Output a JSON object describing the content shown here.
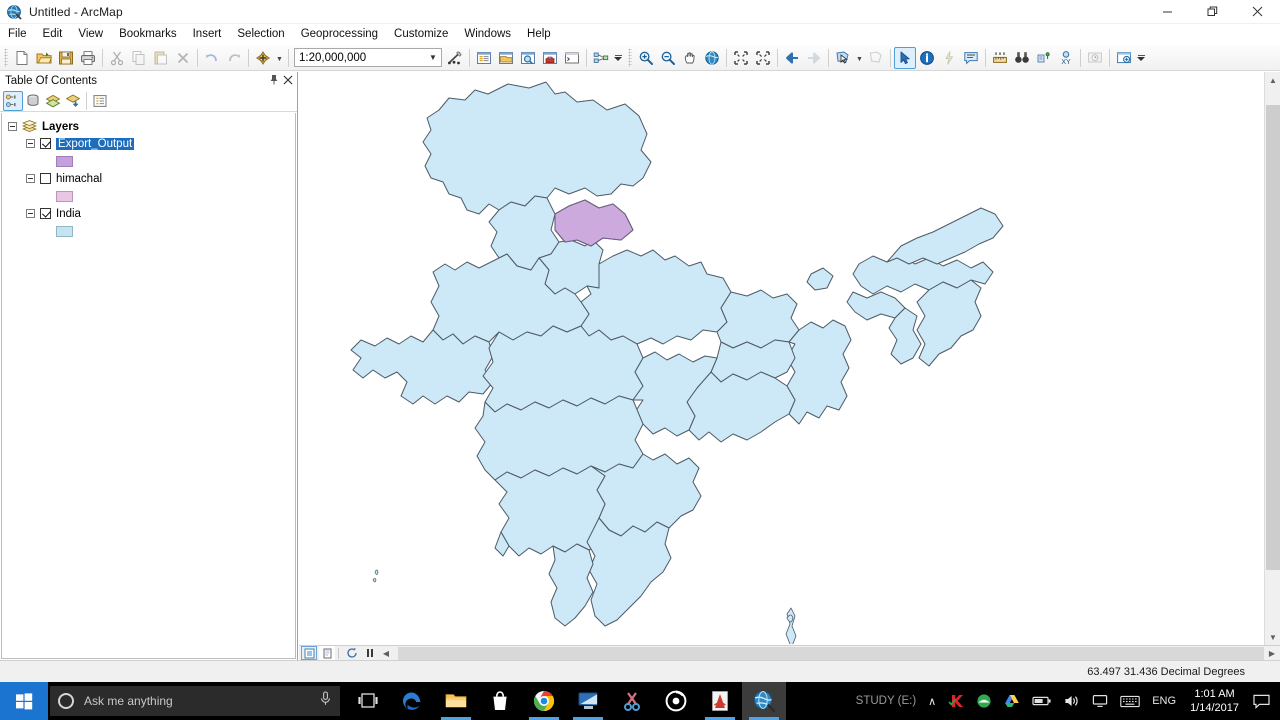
{
  "window": {
    "title": "Untitled - ArcMap",
    "app_icon": "arcmap-globe-icon",
    "minimize": "—",
    "maximize": "❐",
    "close": "✕"
  },
  "menubar": {
    "items": [
      {
        "label": "File",
        "name": "menu-file"
      },
      {
        "label": "Edit",
        "name": "menu-edit"
      },
      {
        "label": "View",
        "name": "menu-view"
      },
      {
        "label": "Bookmarks",
        "name": "menu-bookmarks"
      },
      {
        "label": "Insert",
        "name": "menu-insert"
      },
      {
        "label": "Selection",
        "name": "menu-selection"
      },
      {
        "label": "Geoprocessing",
        "name": "menu-geoprocessing"
      },
      {
        "label": "Customize",
        "name": "menu-customize"
      },
      {
        "label": "Windows",
        "name": "menu-windows"
      },
      {
        "label": "Help",
        "name": "menu-help"
      }
    ]
  },
  "toolbar": {
    "scale": {
      "value": "1:20,000,000",
      "chevron": "▼"
    },
    "buttons": [
      {
        "name": "new-map-button",
        "icon": "new-document-icon",
        "enabled": true
      },
      {
        "name": "open-button",
        "icon": "open-folder-icon",
        "enabled": true
      },
      {
        "name": "save-button",
        "icon": "save-disk-icon",
        "enabled": true
      },
      {
        "name": "print-button",
        "icon": "printer-icon",
        "enabled": true
      },
      {
        "name": "cut-button",
        "icon": "scissors-icon",
        "enabled": false
      },
      {
        "name": "copy-button",
        "icon": "copy-icon",
        "enabled": false
      },
      {
        "name": "paste-button",
        "icon": "paste-icon",
        "enabled": false
      },
      {
        "name": "delete-button",
        "icon": "delete-x-icon",
        "enabled": false
      },
      {
        "name": "undo-button",
        "icon": "undo-arrow-icon",
        "enabled": false
      },
      {
        "name": "redo-button",
        "icon": "redo-arrow-icon",
        "enabled": false
      },
      {
        "name": "add-data-button",
        "icon": "add-data-plus-icon",
        "enabled": true
      },
      {
        "name": "editor-toolbar-button",
        "icon": "editor-pencil-icon",
        "enabled": true
      },
      {
        "name": "table-of-contents-button",
        "icon": "toc-window-icon",
        "enabled": true
      },
      {
        "name": "catalog-button",
        "icon": "catalog-window-icon",
        "enabled": true
      },
      {
        "name": "search-window-button",
        "icon": "search-window-icon",
        "enabled": true
      },
      {
        "name": "arctoolbox-button",
        "icon": "toolbox-red-icon",
        "enabled": true
      },
      {
        "name": "python-window-button",
        "icon": "python-window-icon",
        "enabled": true
      },
      {
        "name": "model-builder-button",
        "icon": "model-builder-icon",
        "enabled": true
      },
      {
        "name": "zoom-in-button",
        "icon": "zoom-in-magnifier-icon",
        "enabled": true
      },
      {
        "name": "zoom-out-button",
        "icon": "zoom-out-magnifier-icon",
        "enabled": true
      },
      {
        "name": "pan-button",
        "icon": "pan-hand-icon",
        "enabled": true
      },
      {
        "name": "full-extent-button",
        "icon": "globe-full-extent-icon",
        "enabled": true
      },
      {
        "name": "fixed-zoom-in-button",
        "icon": "fixed-zoom-in-icon",
        "enabled": true
      },
      {
        "name": "fixed-zoom-out-button",
        "icon": "fixed-zoom-out-icon",
        "enabled": true
      },
      {
        "name": "go-back-extent-button",
        "icon": "back-arrow-icon",
        "enabled": true
      },
      {
        "name": "go-next-extent-button",
        "icon": "forward-arrow-icon",
        "enabled": false
      },
      {
        "name": "select-features-button",
        "icon": "select-features-icon",
        "enabled": true
      },
      {
        "name": "clear-selection-button",
        "icon": "clear-selection-icon",
        "enabled": false
      },
      {
        "name": "select-elements-button",
        "icon": "arrow-pointer-icon",
        "enabled": true,
        "active": true
      },
      {
        "name": "identify-button",
        "icon": "identify-info-icon",
        "enabled": true
      },
      {
        "name": "hyperlink-button",
        "icon": "hyperlink-lightning-icon",
        "enabled": false
      },
      {
        "name": "html-popup-button",
        "icon": "html-popup-icon",
        "enabled": true
      },
      {
        "name": "measure-button",
        "icon": "measure-ruler-icon",
        "enabled": true
      },
      {
        "name": "find-button",
        "icon": "find-binoculars-icon",
        "enabled": true
      },
      {
        "name": "find-route-button",
        "icon": "find-route-icon",
        "enabled": true
      },
      {
        "name": "go-to-xy-button",
        "icon": "go-to-xy-icon",
        "enabled": true
      },
      {
        "name": "time-slider-button",
        "icon": "time-slider-clock-icon",
        "enabled": false
      },
      {
        "name": "create-viewer-window-button",
        "icon": "viewer-window-icon",
        "enabled": true
      }
    ]
  },
  "toc": {
    "title": "Table Of Contents",
    "pin_icon": "⚓",
    "close_icon": "✕",
    "toolbar_buttons": [
      {
        "name": "list-by-drawing-order-button",
        "icon": "list-by-drawing-order-icon",
        "active": true
      },
      {
        "name": "list-by-source-button",
        "icon": "list-by-source-icon",
        "active": false
      },
      {
        "name": "list-by-visibility-button",
        "icon": "list-by-visibility-icon",
        "active": false
      },
      {
        "name": "list-by-selection-button",
        "icon": "list-by-selection-icon",
        "active": false
      },
      {
        "name": "options-button",
        "icon": "toc-options-icon",
        "active": false
      }
    ],
    "root": {
      "label": "Layers",
      "icon": "data-frame-icon",
      "expanded": true
    },
    "layers": [
      {
        "label": "Export_Output",
        "checked": true,
        "selected": true,
        "expanded": true,
        "swatch_color": "#c4a0dd",
        "swatch_border": "#9f7fba"
      },
      {
        "label": "himachal",
        "checked": false,
        "selected": false,
        "expanded": true,
        "swatch_color": "#e8c6e4",
        "swatch_border": "#b99ab6"
      },
      {
        "label": "India",
        "checked": true,
        "selected": false,
        "expanded": true,
        "swatch_color": "#c5e4f2",
        "swatch_border": "#93b7c7"
      }
    ]
  },
  "map": {
    "fill_color": "#cde8f6",
    "stroke_color": "#4d5a66",
    "highlight_fill": "#ccaade",
    "highlight_stroke": "#6b5f7d",
    "background": "#ffffff"
  },
  "map_view_bar": {
    "buttons": [
      {
        "name": "data-view-button",
        "icon": "data-view-icon",
        "active": true
      },
      {
        "name": "layout-view-button",
        "icon": "layout-view-icon",
        "active": false
      },
      {
        "name": "refresh-view-button",
        "icon": "refresh-icon",
        "active": false
      },
      {
        "name": "pause-drawing-button",
        "icon": "pause-icon",
        "active": false
      }
    ],
    "scroll_left_arrow": "◀",
    "scroll_right_arrow": "▶",
    "scroll_up_arrow": "▲",
    "scroll_down_arrow": "▼"
  },
  "statusbar": {
    "coordinates": "63.497  31.436 Decimal Degrees"
  },
  "taskbar": {
    "start_icon": "windows-logo-icon",
    "search": {
      "placeholder": "Ask me anything",
      "cortana_icon": "cortana-circle-icon",
      "mic_icon": "microphone-icon"
    },
    "apps": [
      {
        "name": "task-view-button",
        "icon": "task-view-icon",
        "running": false,
        "active": false
      },
      {
        "name": "edge-button",
        "icon": "edge-browser-icon",
        "running": false,
        "active": false
      },
      {
        "name": "file-explorer-button",
        "icon": "file-explorer-icon",
        "running": true,
        "active": false
      },
      {
        "name": "store-button",
        "icon": "microsoft-store-icon",
        "running": false,
        "active": false
      },
      {
        "name": "chrome-button",
        "icon": "chrome-browser-icon",
        "running": true,
        "active": false
      },
      {
        "name": "remote-desktop-button",
        "icon": "remote-desktop-icon",
        "running": true,
        "active": false
      },
      {
        "name": "snipping-tool-button",
        "icon": "snipping-tool-icon",
        "running": false,
        "active": false
      },
      {
        "name": "recorder-button",
        "icon": "screen-recorder-icon",
        "running": false,
        "active": false
      },
      {
        "name": "acrobat-reader-button",
        "icon": "acrobat-reader-icon",
        "running": true,
        "active": false
      },
      {
        "name": "arcmap-button",
        "icon": "arcmap-globe-icon",
        "running": true,
        "active": true
      }
    ],
    "tray": {
      "drive_label": "STUDY (E:)",
      "chevron": "∧",
      "items": [
        {
          "name": "kaspersky-tray-icon",
          "icon": "k-shield-icon"
        },
        {
          "name": "app-green-tray-icon",
          "icon": "green-circle-icon"
        },
        {
          "name": "google-drive-tray-icon",
          "icon": "google-drive-icon"
        },
        {
          "name": "battery-tray-icon",
          "icon": "battery-icon"
        },
        {
          "name": "volume-tray-icon",
          "icon": "speaker-icon"
        },
        {
          "name": "network-tray-icon",
          "icon": "monitor-network-icon"
        },
        {
          "name": "keyboard-tray-icon",
          "icon": "keyboard-icon"
        }
      ],
      "language": "ENG",
      "time": "1:01 AM",
      "date": "1/14/2017",
      "action_center_icon": "notification-bubble-icon"
    }
  }
}
